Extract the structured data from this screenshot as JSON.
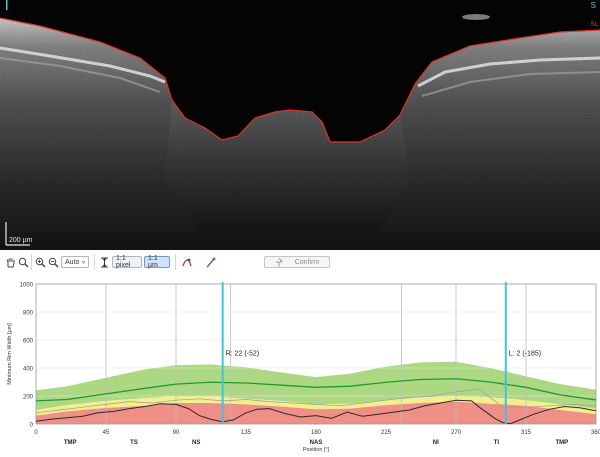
{
  "scan": {
    "scale_label": "200 µm",
    "corner_label": "S",
    "edge_label": "SL"
  },
  "toolbar": {
    "auto_label": "Auto",
    "pixel_label": "1:1 pixel",
    "um_label": "1:1 µm",
    "confirm_label": "Confirm"
  },
  "icons": [
    "hand-pan-icon",
    "zoom-in-icon",
    "zoom-out-icon",
    "zoom-fit-icon",
    "dropdown-chevron-icon",
    "height-icon",
    "rim-tool-icon",
    "measure-tool-icon",
    "confirm-pin-icon"
  ],
  "chart_data": {
    "type": "line",
    "ylabel": "Minimum Rim Width [µm]",
    "xlabel": "Position [°]",
    "xlim": [
      0,
      360
    ],
    "ylim": [
      0,
      1000
    ],
    "x_ticks": [
      0,
      45,
      90,
      135,
      180,
      225,
      270,
      315,
      360
    ],
    "x_tick_labels": [
      "0",
      "45",
      "90",
      "135",
      "180",
      "225",
      "270",
      "315",
      "360"
    ],
    "y_ticks": [
      0,
      200,
      400,
      600,
      800,
      1000
    ],
    "y_tick_labels": [
      "0",
      "200",
      "400",
      "600",
      "800",
      "1000"
    ],
    "sector_labels": [
      {
        "x": 22,
        "label": "TMP"
      },
      {
        "x": 63,
        "label": "TS"
      },
      {
        "x": 103,
        "label": "NS"
      },
      {
        "x": 180,
        "label": "NAS"
      },
      {
        "x": 257,
        "label": "NI"
      },
      {
        "x": 296,
        "label": "TI"
      },
      {
        "x": 338,
        "label": "TMP"
      }
    ],
    "sector_lines": [
      45,
      90,
      125,
      235,
      270,
      315
    ],
    "markers": [
      {
        "x": 120,
        "label": "R: 22 (-52)"
      },
      {
        "x": 302,
        "label": "L: 2 (-185)"
      }
    ],
    "bands": {
      "x": [
        0,
        20,
        45,
        70,
        90,
        112,
        135,
        157,
        180,
        202,
        225,
        247,
        270,
        292,
        315,
        337,
        360
      ],
      "red_upper": [
        60,
        90,
        115,
        130,
        150,
        150,
        140,
        125,
        105,
        110,
        135,
        150,
        160,
        145,
        130,
        100,
        70
      ],
      "yellow_upper": [
        100,
        135,
        165,
        185,
        200,
        200,
        180,
        165,
        140,
        145,
        170,
        190,
        200,
        190,
        170,
        140,
        110
      ],
      "green_upper": [
        240,
        270,
        330,
        390,
        420,
        425,
        405,
        370,
        335,
        360,
        410,
        440,
        445,
        400,
        340,
        285,
        245
      ]
    },
    "series": [
      {
        "name": "",
        "color": "#1f9a2e",
        "values": [
          165,
          175,
          215,
          255,
          285,
          298,
          293,
          278,
          262,
          270,
          298,
          318,
          323,
          300,
          262,
          208,
          172
        ]
      },
      {
        "name": "",
        "color": "#2b2b2b",
        "x": [
          0,
          10,
          20,
          30,
          40,
          50,
          60,
          70,
          80,
          90,
          98,
          105,
          112,
          120,
          127,
          135,
          142,
          150,
          160,
          170,
          180,
          190,
          200,
          210,
          220,
          230,
          240,
          250,
          260,
          270,
          280,
          285,
          290,
          295,
          300,
          305,
          310,
          320,
          330,
          340,
          350,
          360
        ],
        "values": [
          20,
          35,
          45,
          55,
          80,
          90,
          110,
          125,
          145,
          140,
          110,
          60,
          35,
          15,
          30,
          80,
          105,
          110,
          75,
          50,
          60,
          40,
          85,
          55,
          70,
          85,
          100,
          130,
          150,
          170,
          165,
          120,
          80,
          40,
          10,
          2,
          25,
          70,
          105,
          125,
          115,
          95
        ]
      },
      {
        "name": "",
        "color": "#9a9a9a",
        "x": [
          0,
          15,
          30,
          45,
          60,
          75,
          90,
          105,
          120,
          135,
          150,
          165,
          180,
          195,
          210,
          225,
          240,
          255,
          270,
          285,
          300,
          315,
          330,
          345,
          360
        ],
        "values": [
          80,
          100,
          120,
          140,
          160,
          150,
          170,
          180,
          165,
          175,
          160,
          150,
          140,
          130,
          150,
          170,
          190,
          200,
          230,
          250,
          120,
          120,
          130,
          140,
          130
        ]
      }
    ]
  }
}
